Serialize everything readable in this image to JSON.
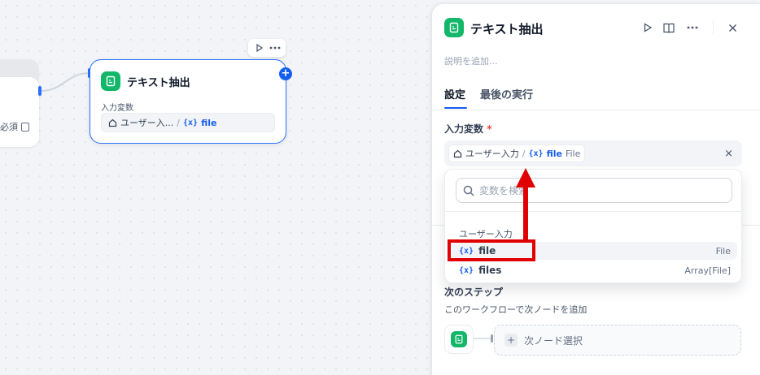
{
  "canvas": {
    "start_node": {
      "required_label": "必須"
    },
    "node": {
      "title": "テキスト抽出",
      "input_label": "入力変数",
      "source_label": "ユーザー入...",
      "var_separator": "/",
      "var_prefix": "{x}",
      "var_name": "file"
    }
  },
  "panel": {
    "title": "テキスト抽出",
    "description_placeholder": "説明を追加...",
    "tabs": [
      {
        "label": "設定",
        "active": true
      },
      {
        "label": "最後の実行",
        "active": false
      }
    ],
    "input_field": {
      "label": "入力変数",
      "required_mark": "*",
      "selected": {
        "source": "ユーザー入力",
        "separator": "/",
        "var_prefix": "{x}",
        "var_name": "file",
        "var_type": "File"
      },
      "clear_glyph": "×"
    },
    "dropdown": {
      "search_placeholder": "変数を検索",
      "search_value": "",
      "group_title": "ユーザー入力",
      "items": [
        {
          "prefix": "{x}",
          "name": "file",
          "type": "File"
        },
        {
          "prefix": "{x}",
          "name": "files",
          "type": "Array[File]"
        }
      ]
    },
    "next_step": {
      "title": "次のステップ",
      "description": "このワークフローで次ノードを追加",
      "select_label": "次ノード選択",
      "plus_glyph": "+"
    }
  },
  "colors": {
    "accent": "#155eef",
    "node_icon": "#12b76a",
    "annotation": "#e00000"
  },
  "icons": [
    "document-icon",
    "play-icon",
    "book-icon",
    "more-icon",
    "close-icon",
    "home-icon",
    "search-icon",
    "plus-icon"
  ]
}
